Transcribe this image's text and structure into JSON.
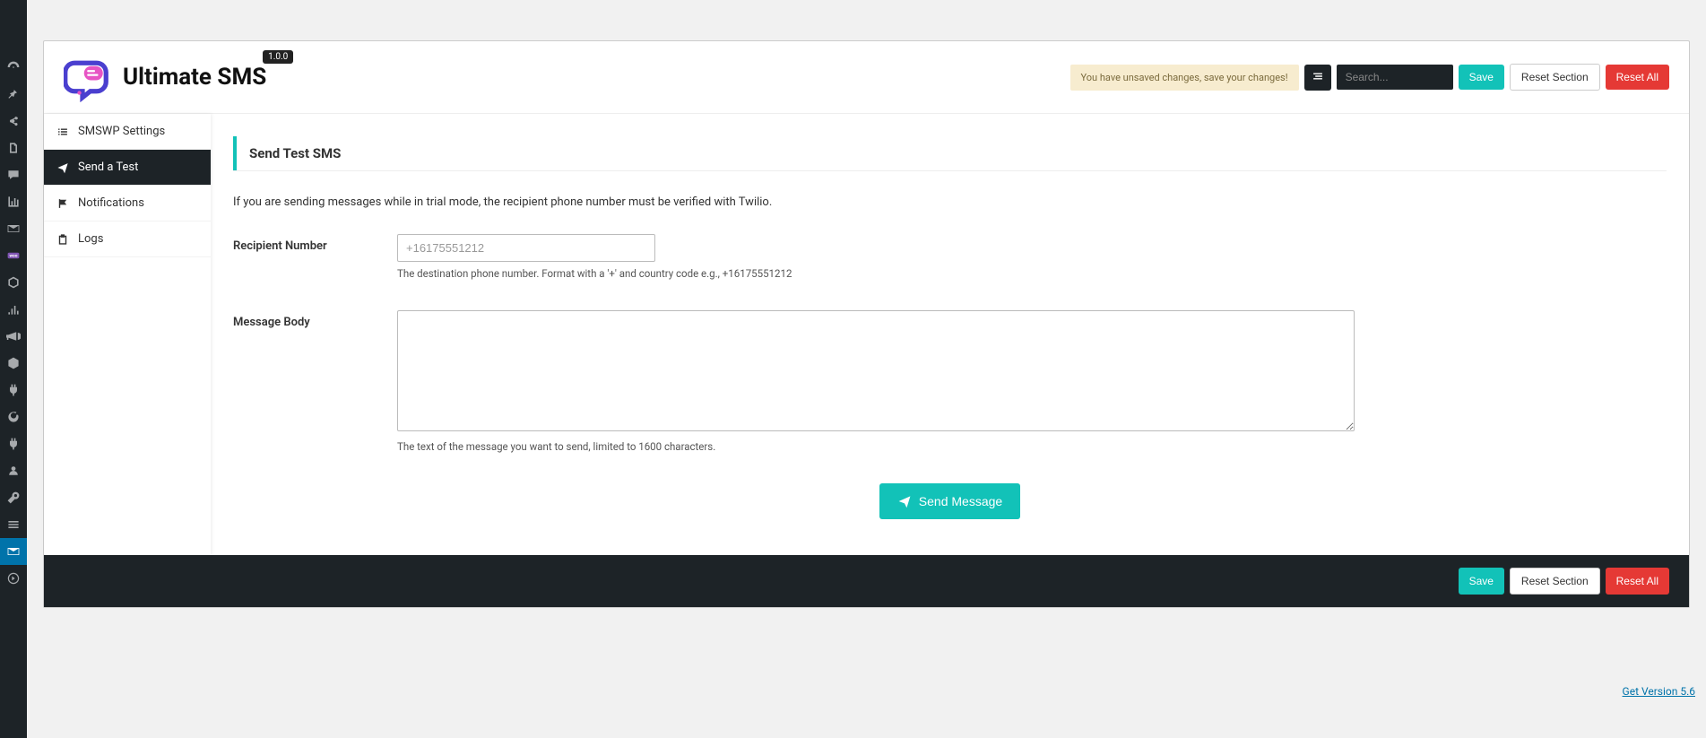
{
  "wp_sidebar": {
    "items": [
      "dashboard",
      "pin",
      "share",
      "page",
      "comments",
      "analytics",
      "email",
      "woo",
      "cube",
      "stats",
      "megaphone",
      "cube2",
      "plugin",
      "refresh",
      "tool",
      "user",
      "wrench",
      "grid"
    ],
    "active": "envelope"
  },
  "header": {
    "title": "Ultimate SMS",
    "version_badge": "1.0.0",
    "unsaved_message": "You have unsaved changes, save your changes!",
    "search_placeholder": "Search...",
    "save_label": "Save",
    "reset_section_label": "Reset Section",
    "reset_all_label": "Reset All"
  },
  "nav": {
    "items": [
      {
        "icon": "list",
        "label": "SMSWP Settings"
      },
      {
        "icon": "paper-plane",
        "label": "Send a Test"
      },
      {
        "icon": "flag",
        "label": "Notifications"
      },
      {
        "icon": "clipboard",
        "label": "Logs"
      }
    ],
    "active_index": 1
  },
  "content": {
    "section_title": "Send Test SMS",
    "hint": "If you are sending messages while in trial mode, the recipient phone number must be verified with Twilio.",
    "recipient": {
      "label": "Recipient Number",
      "placeholder": "+16175551212",
      "help": "The destination phone number. Format with a '+' and country code e.g., +16175551212"
    },
    "message": {
      "label": "Message Body",
      "help": "The text of the message you want to send, limited to 1600 characters."
    },
    "send_button": "Send Message"
  },
  "footer": {
    "save_label": "Save",
    "reset_section_label": "Reset Section",
    "reset_all_label": "Reset All"
  },
  "version_link": "Get Version 5.6"
}
